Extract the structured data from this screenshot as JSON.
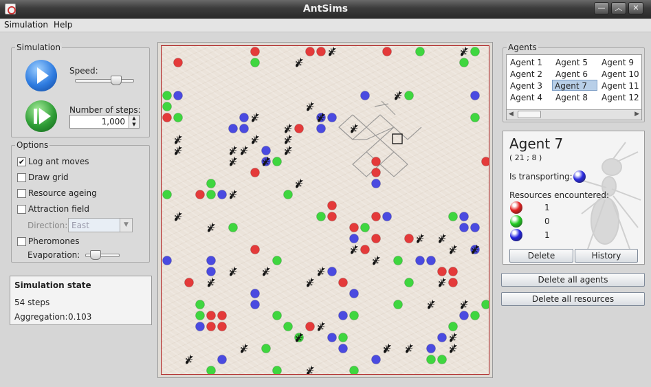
{
  "window": {
    "title": "AntSims"
  },
  "menu": {
    "items": [
      "Simulation",
      "Help"
    ]
  },
  "simulation_panel": {
    "title": "Simulation",
    "speed_label": "Speed:",
    "speed_level": 0.7,
    "steps_label": "Number of steps:",
    "steps_value": "1,000"
  },
  "options": {
    "title": "Options",
    "log_ant_moves": {
      "label": "Log ant moves",
      "checked": true
    },
    "draw_grid": {
      "label": "Draw grid",
      "checked": false
    },
    "resource_ageing": {
      "label": "Resource ageing",
      "checked": false
    },
    "attraction_field": {
      "label": "Attraction field",
      "checked": false
    },
    "direction_label": "Direction:",
    "direction_value": "East",
    "pheromones": {
      "label": "Pheromones",
      "checked": false
    },
    "evaporation_label": "Evaporation:",
    "evaporation_level": 0.3
  },
  "state": {
    "title": "Simulation state",
    "steps": "54 steps",
    "aggregation_label": "Aggregation:",
    "aggregation_value": "0.103"
  },
  "agents": {
    "title": "Agents",
    "list": [
      "Agent 1",
      "Agent 2",
      "Agent 3",
      "Agent 4",
      "Agent 5",
      "Agent 6",
      "Agent 7",
      "Agent 8",
      "Agent 9",
      "Agent 10",
      "Agent 11",
      "Agent 12"
    ],
    "selected": "Agent 7"
  },
  "agent_detail": {
    "name": "Agent 7",
    "coords": "( 21 ; 8 )",
    "transporting_label": "Is transporting:",
    "transporting_color": "#2a2ae0",
    "resources_label": "Resources encountered:",
    "resources": [
      {
        "color": "#e22020",
        "count": "1"
      },
      {
        "color": "#22cc22",
        "count": "0"
      },
      {
        "color": "#2222dd",
        "count": "1"
      }
    ],
    "delete_label": "Delete",
    "history_label": "History"
  },
  "buttons": {
    "delete_all_agents": "Delete all agents",
    "delete_all_resources": "Delete all resources"
  },
  "colors": {
    "red": "#e43a3a",
    "green": "#3fd63f",
    "blue": "#4a4ae0",
    "border": "#a11111"
  }
}
